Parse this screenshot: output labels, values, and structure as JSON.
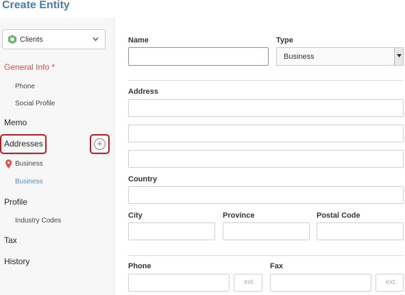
{
  "page": {
    "title": "Create Entity"
  },
  "sidebar": {
    "selector_label": "Clients",
    "general_info": "General Info",
    "required_mark": "*",
    "phone": "Phone",
    "social_profile": "Social Profile",
    "memo": "Memo",
    "addresses": "Addresses",
    "add_address_symbol": "+",
    "address_business_pin": "Business",
    "address_business": "Business",
    "profile": "Profile",
    "industry_codes": "Industry Codes",
    "tax": "Tax",
    "history": "History"
  },
  "form": {
    "name_label": "Name",
    "name_value": "",
    "type_label": "Type",
    "type_value": "Business",
    "address_label": "Address",
    "country_label": "Country",
    "city_label": "City",
    "province_label": "Province",
    "postal_code_label": "Postal Code",
    "phone_label": "Phone",
    "fax_label": "Fax",
    "ext_placeholder": "ext."
  },
  "colors": {
    "title": "#4a7ea8",
    "required": "#d9534f",
    "active_sub": "#4a90c8",
    "highlight": "#c0191f",
    "selector_icon": "#5cb85c"
  },
  "icons": {
    "selector": "hexagon-icon",
    "dropdown": "chevron-down-icon",
    "add": "plus-circle-icon",
    "map_pin": "map-pin-icon"
  }
}
